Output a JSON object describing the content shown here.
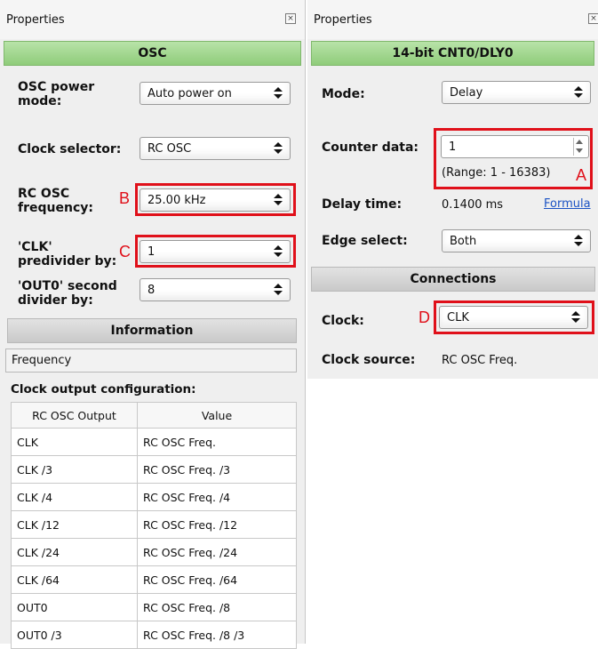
{
  "left_panel": {
    "title": "Properties",
    "close": "×",
    "section_title": "OSC",
    "power_mode": {
      "label": "OSC power mode:",
      "value": "Auto power on"
    },
    "clock_selector": {
      "label": "Clock selector:",
      "value": "RC OSC"
    },
    "rc_osc_freq": {
      "label": "RC OSC frequency:",
      "value": "25.00 kHz"
    },
    "clk_predivider": {
      "label": "'CLK' predivider by:",
      "value": "1"
    },
    "out0_divider": {
      "label": "'OUT0' second divider by:",
      "value": "8"
    },
    "information_header": "Information",
    "frequency_label": "Frequency",
    "clock_output_title": "Clock output configuration:",
    "table": {
      "headers": [
        "RC OSC Output",
        "Value"
      ],
      "rows": [
        [
          "CLK",
          "RC OSC Freq."
        ],
        [
          "CLK /3",
          "RC OSC Freq. /3"
        ],
        [
          "CLK /4",
          "RC OSC Freq. /4"
        ],
        [
          "CLK /12",
          "RC OSC Freq. /12"
        ],
        [
          "CLK /24",
          "RC OSC Freq. /24"
        ],
        [
          "CLK /64",
          "RC OSC Freq. /64"
        ],
        [
          "OUT0",
          "RC OSC Freq. /8"
        ],
        [
          "OUT0 /3",
          "RC OSC Freq. /8 /3"
        ]
      ]
    }
  },
  "right_panel": {
    "title": "Properties",
    "close": "×",
    "section_title": "14-bit CNT0/DLY0",
    "mode": {
      "label": "Mode:",
      "value": "Delay"
    },
    "counter_data": {
      "label": "Counter data:",
      "value": "1",
      "range": "(Range:  1 - 16383)"
    },
    "delay_time": {
      "label": "Delay time:",
      "value": "0.1400 ms",
      "link": "Formula"
    },
    "edge_select": {
      "label": "Edge select:",
      "value": "Both"
    },
    "connections_header": "Connections",
    "clock": {
      "label": "Clock:",
      "value": "CLK"
    },
    "clock_source": {
      "label": "Clock source:",
      "value": "RC OSC Freq."
    }
  },
  "annotations": {
    "a": "A",
    "b": "B",
    "c": "C",
    "d": "D"
  },
  "colors": {
    "highlight": "#e0101a",
    "section_green": "#8fcc7a",
    "link": "#1a52c4"
  }
}
